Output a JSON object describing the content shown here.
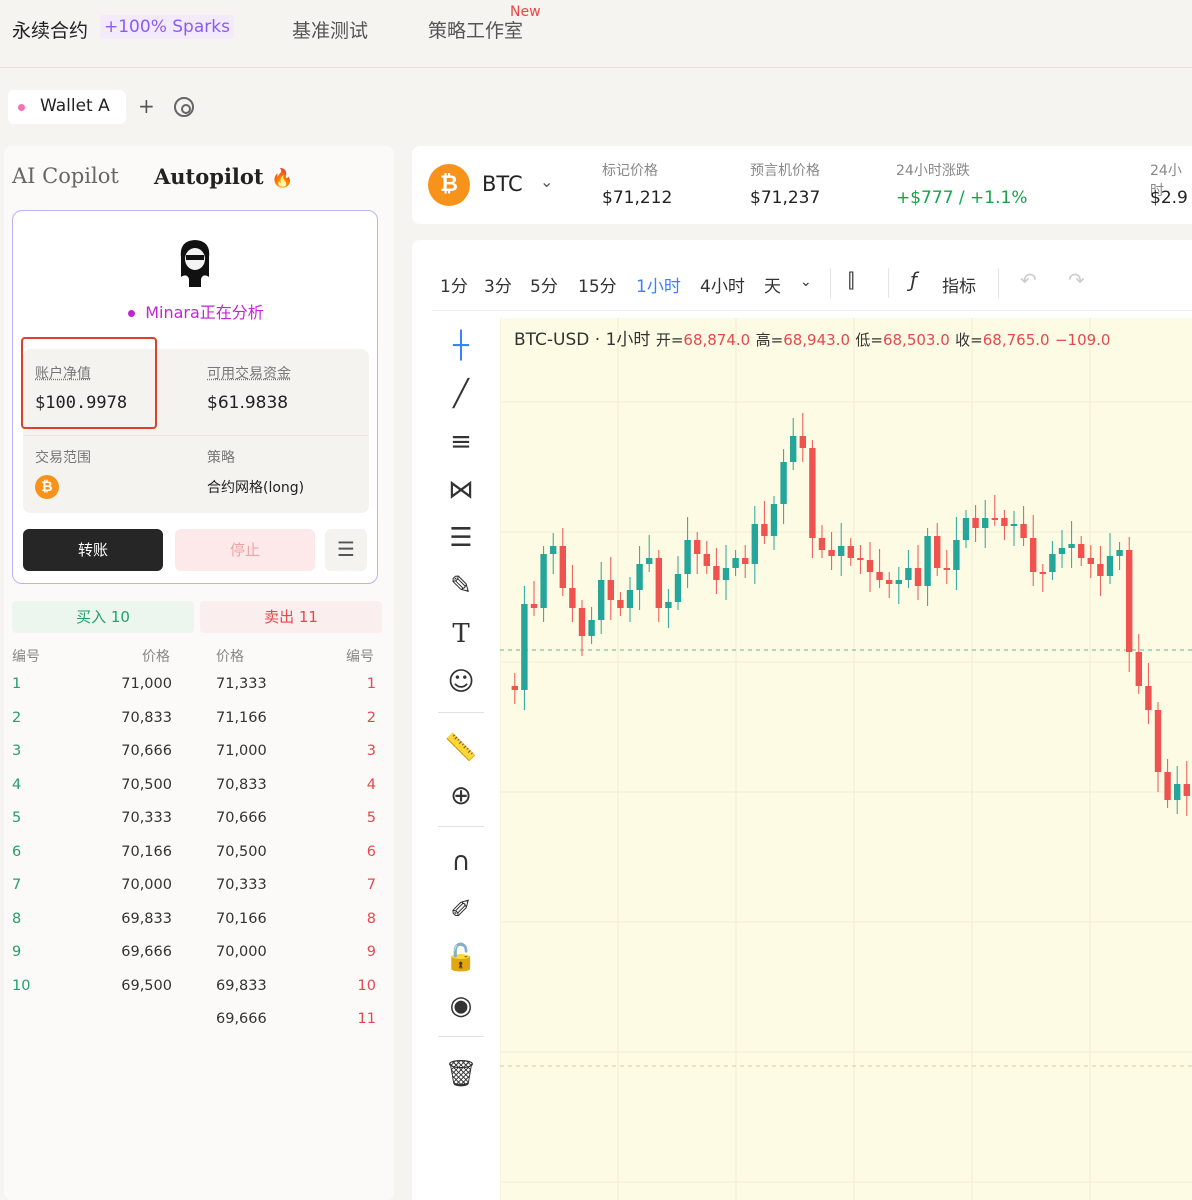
{
  "nav": {
    "perp": "永续合约",
    "sparks": "+100% Sparks",
    "bench": "基准测试",
    "studio": "策略工作室",
    "new_badge": "New"
  },
  "wallet": {
    "name": "Wallet A",
    "add": "+"
  },
  "left": {
    "tab_copilot": "AI Copilot",
    "tab_autopilot": "Autopilot",
    "agent_status": "Minara正在分析",
    "metrics": {
      "equity_label": "账户净值",
      "equity_value": "$100.9978",
      "avail_label": "可用交易资金",
      "avail_value": "$61.9838",
      "range_label": "交易范围",
      "strategy_label": "策略",
      "strategy_value": "合约网格(long)"
    },
    "btn_transfer": "转账",
    "btn_stop": "停止",
    "orderbook": {
      "buy_header": "买入 10",
      "sell_header": "卖出 11",
      "col_no": "编号",
      "col_price": "价格",
      "rows": [
        {
          "bid_no": "1",
          "bid_price": "71,000",
          "ask_price": "71,333",
          "ask_no": "1"
        },
        {
          "bid_no": "2",
          "bid_price": "70,833",
          "ask_price": "71,166",
          "ask_no": "2"
        },
        {
          "bid_no": "3",
          "bid_price": "70,666",
          "ask_price": "71,000",
          "ask_no": "3"
        },
        {
          "bid_no": "4",
          "bid_price": "70,500",
          "ask_price": "70,833",
          "ask_no": "4"
        },
        {
          "bid_no": "5",
          "bid_price": "70,333",
          "ask_price": "70,666",
          "ask_no": "5"
        },
        {
          "bid_no": "6",
          "bid_price": "70,166",
          "ask_price": "70,500",
          "ask_no": "6"
        },
        {
          "bid_no": "7",
          "bid_price": "70,000",
          "ask_price": "70,333",
          "ask_no": "7"
        },
        {
          "bid_no": "8",
          "bid_price": "69,833",
          "ask_price": "70,166",
          "ask_no": "8"
        },
        {
          "bid_no": "9",
          "bid_price": "69,666",
          "ask_price": "70,000",
          "ask_no": "9"
        },
        {
          "bid_no": "10",
          "bid_price": "69,500",
          "ask_price": "69,833",
          "ask_no": "10"
        },
        {
          "bid_no": "",
          "bid_price": "",
          "ask_price": "69,666",
          "ask_no": "11"
        }
      ]
    }
  },
  "ticker": {
    "symbol": "BTC",
    "mark_label": "标记价格",
    "mark_value": "$71,212",
    "oracle_label": "预言机价格",
    "oracle_value": "$71,237",
    "change_label": "24小时涨跌",
    "change_value": "+$777 / +1.1%",
    "vol_label": "24小时",
    "vol_value": "$2.9"
  },
  "chart": {
    "timeframes": [
      "1分",
      "3分",
      "5分",
      "15分",
      "1小时",
      "4小时",
      "天"
    ],
    "active_timeframe": "1小时",
    "indicators_label": "指标",
    "legend": {
      "symbol": "BTC-USD · 1小时",
      "open_label": "开=",
      "open": "68,874.0",
      "high_label": "高=",
      "high": "68,943.0",
      "low_label": "低=",
      "low": "68,503.0",
      "close_label": "收=",
      "close": "68,765.0",
      "change": "−109.0"
    },
    "colors": {
      "up": "#26a69a",
      "down": "#ef5350",
      "bg": "#fefbe5"
    }
  }
}
